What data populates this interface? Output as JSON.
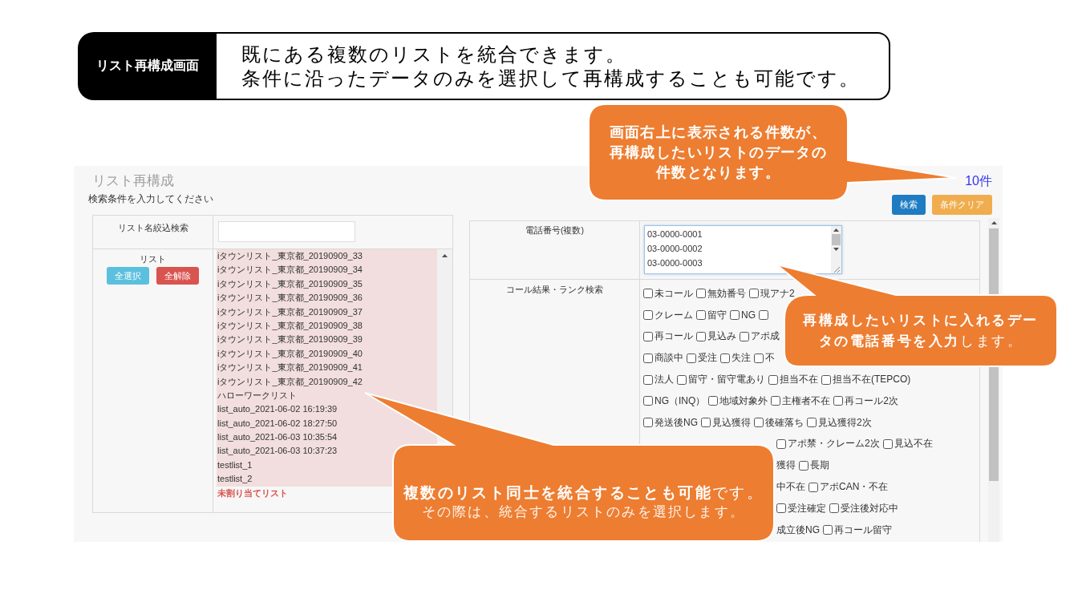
{
  "banner": {
    "label": "リスト再構成画面",
    "lines": [
      "既にある複数のリストを統合できます。",
      "条件に沿ったデータのみを選択して再構成することも可能です。"
    ]
  },
  "screen": {
    "title": "リスト再構成",
    "count": "10件",
    "instruction": "検索条件を入力してください",
    "buttons": [
      {
        "label": "検索",
        "kind": "search"
      },
      {
        "label": "条件クリア",
        "kind": "clear"
      }
    ],
    "list_panel": {
      "filter_label": "リスト名絞込検索",
      "list_label": "リスト",
      "buttons": [
        {
          "label": "全選択",
          "kind": "select-all"
        },
        {
          "label": "全解除",
          "kind": "deselect-all"
        }
      ],
      "options": [
        {
          "label": "iタウンリスト_東京都_20190909_33",
          "kind": "list",
          "selected": true
        },
        {
          "label": "iタウンリスト_東京都_20190909_34",
          "kind": "list",
          "selected": true
        },
        {
          "label": "iタウンリスト_東京都_20190909_35",
          "kind": "list",
          "selected": true
        },
        {
          "label": "iタウンリスト_東京都_20190909_36",
          "kind": "list",
          "selected": true
        },
        {
          "label": "iタウンリスト_東京都_20190909_37",
          "kind": "list",
          "selected": true
        },
        {
          "label": "iタウンリスト_東京都_20190909_38",
          "kind": "list",
          "selected": true
        },
        {
          "label": "iタウンリスト_東京都_20190909_39",
          "kind": "list",
          "selected": true
        },
        {
          "label": "iタウンリスト_東京都_20190909_40",
          "kind": "list",
          "selected": true
        },
        {
          "label": "iタウンリスト_東京都_20190909_41",
          "kind": "list",
          "selected": true
        },
        {
          "label": "iタウンリスト_東京都_20190909_42",
          "kind": "list",
          "selected": true
        },
        {
          "label": "ハローワークリスト",
          "kind": "list",
          "selected": true
        },
        {
          "label": "list_auto_2021-06-02 16:19:39",
          "kind": "list",
          "selected": true
        },
        {
          "label": "list_auto_2021-06-02 18:27:50",
          "kind": "list",
          "selected": true
        },
        {
          "label": "list_auto_2021-06-03 10:35:54",
          "kind": "list",
          "selected": true
        },
        {
          "label": "list_auto_2021-06-03 10:37:23",
          "kind": "list",
          "selected": true
        },
        {
          "label": "testlist_1",
          "kind": "list",
          "selected": true
        },
        {
          "label": "testlist_2",
          "kind": "list",
          "selected": true
        },
        {
          "label": "未割り当てリスト",
          "kind": "unassigned",
          "selected": false
        }
      ]
    },
    "condition_panel": {
      "phone_label": "電話番号(複数)",
      "phone_value": "03-0000-0001\n03-0000-0002\n03-0000-0003",
      "result_label": "コール結果・ランク検索",
      "checkbox_rows": [
        {
          "kind": "visible",
          "items": [
            {
              "kind": "checkbox",
              "label": "未コール",
              "checked": false
            },
            {
              "kind": "checkbox",
              "label": "無効番号",
              "checked": false
            },
            {
              "kind": "checkbox",
              "label": "現アナ2",
              "checked": false
            }
          ]
        },
        {
          "kind": "visible",
          "items": [
            {
              "kind": "checkbox",
              "label": "クレーム",
              "checked": false
            },
            {
              "kind": "checkbox",
              "label": "留守",
              "checked": false
            },
            {
              "kind": "checkbox",
              "label": "NG",
              "checked": false
            },
            {
              "kind": "box",
              "checked": false
            }
          ]
        },
        {
          "kind": "visible",
          "items": [
            {
              "kind": "checkbox",
              "label": "再コール",
              "checked": false
            },
            {
              "kind": "checkbox",
              "label": "見込み",
              "checked": false
            },
            {
              "kind": "checkbox",
              "label": "アポ成",
              "checked": false
            }
          ]
        },
        {
          "kind": "visible",
          "items": [
            {
              "kind": "checkbox",
              "label": "商談中",
              "checked": false
            },
            {
              "kind": "checkbox",
              "label": "受注",
              "checked": false
            },
            {
              "kind": "checkbox",
              "label": "失注",
              "checked": false
            },
            {
              "kind": "checkbox",
              "label": "不",
              "checked": false
            }
          ]
        },
        {
          "kind": "visible",
          "items": [
            {
              "kind": "checkbox",
              "label": "法人",
              "checked": false
            },
            {
              "kind": "checkbox",
              "label": "留守・留守電あり",
              "checked": false
            },
            {
              "kind": "checkbox",
              "label": "担当不在",
              "checked": false
            },
            {
              "kind": "checkbox",
              "label": "担当不在(TEPCO)",
              "checked": false
            }
          ]
        },
        {
          "kind": "visible",
          "items": [
            {
              "kind": "checkbox",
              "label": "NG（INQ）",
              "checked": false
            },
            {
              "kind": "checkbox",
              "label": "地域対象外",
              "checked": false
            },
            {
              "kind": "checkbox",
              "label": "主権者不在",
              "checked": false
            },
            {
              "kind": "checkbox",
              "label": "再コール2次",
              "checked": false
            }
          ]
        },
        {
          "kind": "visible",
          "items": [
            {
              "kind": "checkbox",
              "label": "発送後NG",
              "checked": false
            },
            {
              "kind": "checkbox",
              "label": "見込獲得",
              "checked": false
            },
            {
              "kind": "checkbox",
              "label": "後確落ち",
              "checked": false
            },
            {
              "kind": "checkbox",
              "label": "見込獲得2次",
              "checked": false
            }
          ]
        },
        {
          "kind": "covered",
          "items": [
            {
              "kind": "checkbox",
              "label": "アポ禁・クレーム2次",
              "checked": false
            },
            {
              "kind": "checkbox",
              "label": "見込不在",
              "checked": false
            }
          ]
        },
        {
          "kind": "covered",
          "items": [
            {
              "kind": "label",
              "label": "獲得"
            },
            {
              "kind": "checkbox",
              "label": "長期",
              "checked": false
            }
          ]
        },
        {
          "kind": "covered",
          "items": [
            {
              "kind": "label",
              "label": "中不在"
            },
            {
              "kind": "checkbox",
              "label": "アポCAN・不在",
              "checked": false
            }
          ]
        },
        {
          "kind": "covered",
          "items": [
            {
              "kind": "checkbox",
              "label": "受注確定",
              "checked": false
            },
            {
              "kind": "checkbox",
              "label": "受注後対応中",
              "checked": false
            }
          ]
        },
        {
          "kind": "covered",
          "items": [
            {
              "kind": "label",
              "label": "成立後NG"
            },
            {
              "kind": "checkbox",
              "label": "再コール留守",
              "checked": false
            }
          ]
        }
      ]
    }
  },
  "callouts": [
    {
      "text": "画面右上に表示される件数が、再構成したいリストのデータの件数となります。"
    },
    {
      "text": "**再構成したいリストに入れるデータの電話番号を入力**します。"
    },
    {
      "text": "**複数のリスト同士を統合することも可能**です。",
      "note": "その際は、統合するリストのみを選択します。"
    }
  ]
}
